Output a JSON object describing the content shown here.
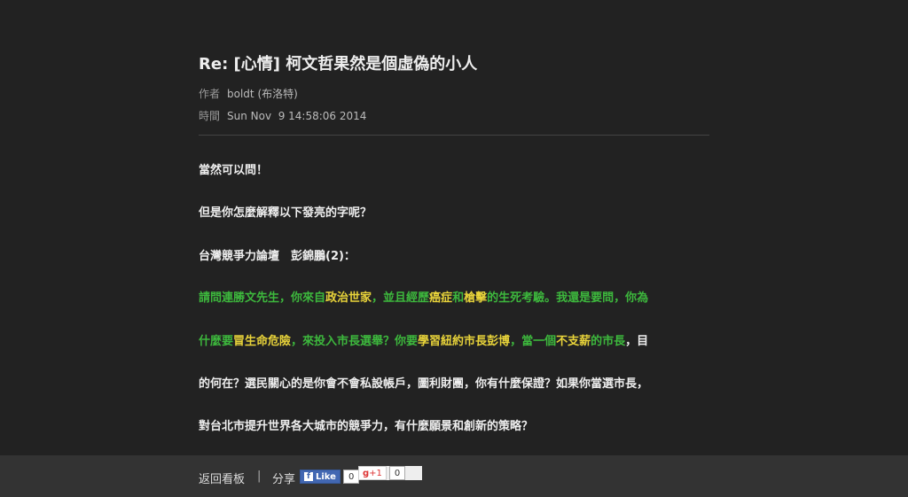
{
  "title": "Re: [心情] 柯文哲果然是個虛偽的小人",
  "author_label": "作者",
  "author": "boldt (布洛特)",
  "time_label": "時間",
  "time": "Sun Nov  9 14:58:06 2014",
  "body": {
    "l1": "當然可以問！",
    "l2": "但是你怎麼解釋以下發亮的字呢？",
    "l3": "台灣競爭力論壇　彭錦鵬(2)：",
    "l4": [
      [
        "g",
        "請問連勝文先生，你來自"
      ],
      [
        "y",
        "政治世家"
      ],
      [
        "g",
        "，並且經歷"
      ],
      [
        "y",
        "癌症"
      ],
      [
        "g",
        "和"
      ],
      [
        "y",
        "槍擊"
      ],
      [
        "g",
        "的生死考驗。我還是要問，你為"
      ]
    ],
    "l5": [
      [
        "g",
        "什麼要"
      ],
      [
        "y",
        "冒生命危險"
      ],
      [
        "g",
        "，來投入市長選舉？你要"
      ],
      [
        "y",
        "學習紐約市長彭博"
      ],
      [
        "g",
        "，當一個"
      ],
      [
        "y",
        "不支薪"
      ],
      [
        "g",
        "的市長"
      ],
      [
        "w",
        "，目"
      ]
    ],
    "l6": "的何在？選民關心的是你會不會私設帳戶，圖利財團，你有什麼保證？如果你當選市長，",
    "l7": "對台北市提升世界各大城市的競爭力，有什麼願景和創新的策略？"
  },
  "footer": {
    "back": "返回看板",
    "sep": "|",
    "share": "分享",
    "fb_like": "Like",
    "fb_count": "0",
    "gplus": "+1",
    "gplus_count": "0"
  },
  "colors": {
    "green": "#3db83d",
    "yellow": "#e8d33a"
  }
}
